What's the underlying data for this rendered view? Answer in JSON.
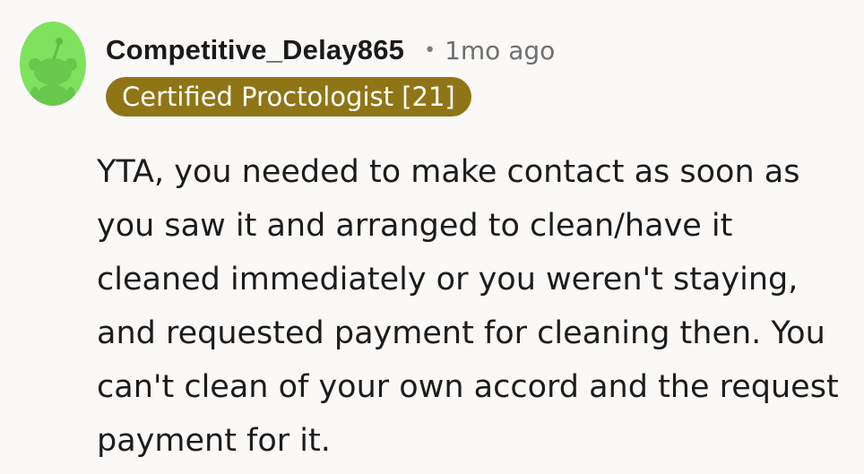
{
  "comment": {
    "author": "Competitive_Delay865",
    "separator": "•",
    "timestamp": "1mo ago",
    "flair": "Certified Proctologist [21]",
    "body": "YTA, you needed to make contact as soon as you saw it and arranged to clean/have it cleaned immediately or you weren't staying, and requested payment for cleaning then. You can't clean of your own accord and the request payment for it.",
    "avatar_icon": "snoo-avatar-icon"
  },
  "colors": {
    "background": "#fbf9f7",
    "avatar_bg": "#7ee25f",
    "flair_bg": "#8f7516",
    "flair_text": "#ffffff",
    "timestamp": "#6f6f6f"
  }
}
